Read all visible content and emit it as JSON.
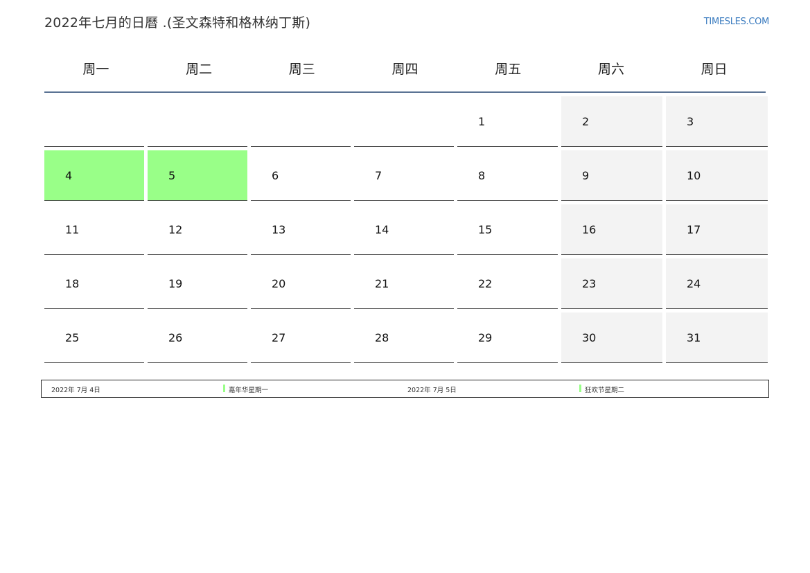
{
  "title": "2022年七月的日曆 .(圣文森特和格林纳丁斯)",
  "site": "TIMESLES.COM",
  "weekdays": [
    "周一",
    "周二",
    "周三",
    "周四",
    "周五",
    "周六",
    "周日"
  ],
  "colors": {
    "holiday": "#99ff88",
    "weekend": "#f3f3f3",
    "header_rule": "#5a7394",
    "link": "#3a7bbf"
  },
  "weeks": [
    [
      {
        "day": "",
        "type": "normal"
      },
      {
        "day": "",
        "type": "normal"
      },
      {
        "day": "",
        "type": "normal"
      },
      {
        "day": "",
        "type": "normal"
      },
      {
        "day": "1",
        "type": "normal"
      },
      {
        "day": "2",
        "type": "weekend"
      },
      {
        "day": "3",
        "type": "weekend"
      }
    ],
    [
      {
        "day": "4",
        "type": "holiday"
      },
      {
        "day": "5",
        "type": "holiday"
      },
      {
        "day": "6",
        "type": "normal"
      },
      {
        "day": "7",
        "type": "normal"
      },
      {
        "day": "8",
        "type": "normal"
      },
      {
        "day": "9",
        "type": "weekend"
      },
      {
        "day": "10",
        "type": "weekend"
      }
    ],
    [
      {
        "day": "11",
        "type": "normal"
      },
      {
        "day": "12",
        "type": "normal"
      },
      {
        "day": "13",
        "type": "normal"
      },
      {
        "day": "14",
        "type": "normal"
      },
      {
        "day": "15",
        "type": "normal"
      },
      {
        "day": "16",
        "type": "weekend"
      },
      {
        "day": "17",
        "type": "weekend"
      }
    ],
    [
      {
        "day": "18",
        "type": "normal"
      },
      {
        "day": "19",
        "type": "normal"
      },
      {
        "day": "20",
        "type": "normal"
      },
      {
        "day": "21",
        "type": "normal"
      },
      {
        "day": "22",
        "type": "normal"
      },
      {
        "day": "23",
        "type": "weekend"
      },
      {
        "day": "24",
        "type": "weekend"
      }
    ],
    [
      {
        "day": "25",
        "type": "normal"
      },
      {
        "day": "26",
        "type": "normal"
      },
      {
        "day": "27",
        "type": "normal"
      },
      {
        "day": "28",
        "type": "normal"
      },
      {
        "day": "29",
        "type": "normal"
      },
      {
        "day": "30",
        "type": "weekend"
      },
      {
        "day": "31",
        "type": "weekend"
      }
    ]
  ],
  "legend": [
    {
      "date": "2022年 7月 4日",
      "name": "嘉年华星期一"
    },
    {
      "date": "2022年 7月 5日",
      "name": "狂欢节星期二"
    }
  ]
}
